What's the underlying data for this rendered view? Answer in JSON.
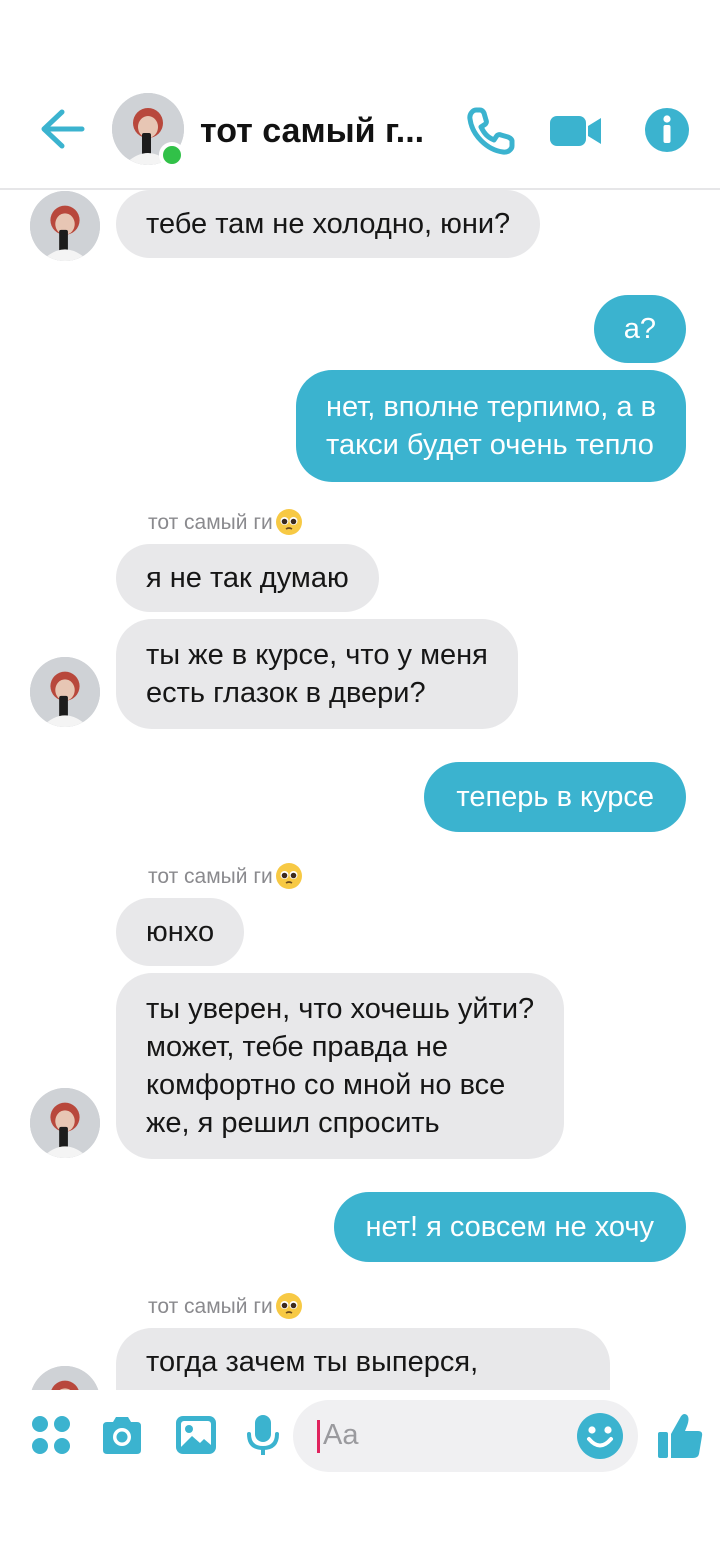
{
  "header": {
    "title": "тот самый г...",
    "online": true
  },
  "colors": {
    "accent": "#3bb3cf",
    "incoming_bubble": "#e8e8ea",
    "online": "#31c148"
  },
  "icons": {
    "back": "arrow-left-icon",
    "call": "phone-icon",
    "video": "video-camera-icon",
    "info": "info-icon",
    "menu": "four-dots-icon",
    "camera": "camera-icon",
    "gallery": "image-icon",
    "mic": "microphone-icon",
    "emoji": "smiley-icon",
    "like": "thumbs-up-icon"
  },
  "messages": [
    {
      "from": "them",
      "text": "тебе там не холодно, юни?"
    },
    {
      "from": "me",
      "text": "а?"
    },
    {
      "from": "me",
      "lines": [
        "нет, вполне терпимо, а в",
        "такси будет очень тепло"
      ]
    },
    {
      "from": "them",
      "sender": "тот самый ги",
      "text": "я не так думаю"
    },
    {
      "from": "them",
      "lines": [
        "ты же в курсе, что у меня",
        "есть глазок в двери?"
      ]
    },
    {
      "from": "me",
      "text": "теперь в курсе"
    },
    {
      "from": "them",
      "sender": "тот самый ги",
      "text": "юнхо"
    },
    {
      "from": "them",
      "lines": [
        "ты уверен, что хочешь уйти?",
        "может, тебе правда не",
        "комфортно со мной но все",
        "же, я решил спросить"
      ]
    },
    {
      "from": "me",
      "text": "нет! я совсем не хочу"
    },
    {
      "from": "them",
      "sender": "тот самый ги",
      "text": "тогда зачем ты выперся,"
    }
  ],
  "composer": {
    "placeholder": "Aa"
  }
}
